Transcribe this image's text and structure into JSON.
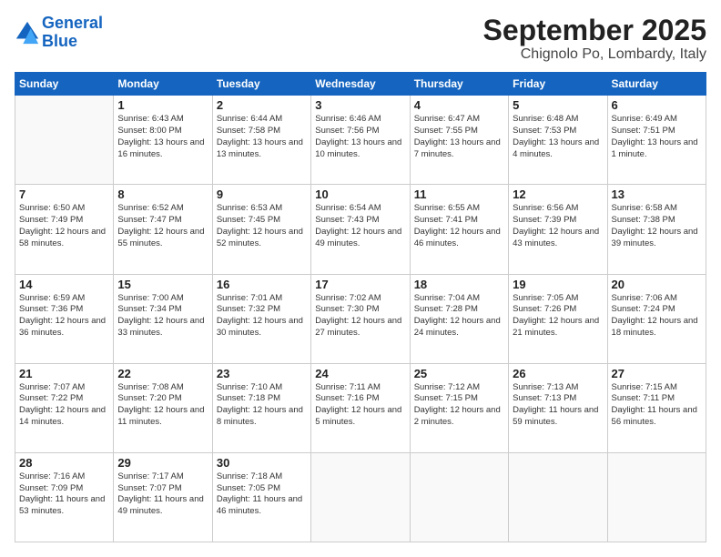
{
  "header": {
    "logo_line1": "General",
    "logo_line2": "Blue",
    "month": "September 2025",
    "location": "Chignolo Po, Lombardy, Italy"
  },
  "weekdays": [
    "Sunday",
    "Monday",
    "Tuesday",
    "Wednesday",
    "Thursday",
    "Friday",
    "Saturday"
  ],
  "weeks": [
    [
      {
        "day": null,
        "info": null
      },
      {
        "day": "1",
        "info": "Sunrise: 6:43 AM\nSunset: 8:00 PM\nDaylight: 13 hours\nand 16 minutes."
      },
      {
        "day": "2",
        "info": "Sunrise: 6:44 AM\nSunset: 7:58 PM\nDaylight: 13 hours\nand 13 minutes."
      },
      {
        "day": "3",
        "info": "Sunrise: 6:46 AM\nSunset: 7:56 PM\nDaylight: 13 hours\nand 10 minutes."
      },
      {
        "day": "4",
        "info": "Sunrise: 6:47 AM\nSunset: 7:55 PM\nDaylight: 13 hours\nand 7 minutes."
      },
      {
        "day": "5",
        "info": "Sunrise: 6:48 AM\nSunset: 7:53 PM\nDaylight: 13 hours\nand 4 minutes."
      },
      {
        "day": "6",
        "info": "Sunrise: 6:49 AM\nSunset: 7:51 PM\nDaylight: 13 hours\nand 1 minute."
      }
    ],
    [
      {
        "day": "7",
        "info": "Sunrise: 6:50 AM\nSunset: 7:49 PM\nDaylight: 12 hours\nand 58 minutes."
      },
      {
        "day": "8",
        "info": "Sunrise: 6:52 AM\nSunset: 7:47 PM\nDaylight: 12 hours\nand 55 minutes."
      },
      {
        "day": "9",
        "info": "Sunrise: 6:53 AM\nSunset: 7:45 PM\nDaylight: 12 hours\nand 52 minutes."
      },
      {
        "day": "10",
        "info": "Sunrise: 6:54 AM\nSunset: 7:43 PM\nDaylight: 12 hours\nand 49 minutes."
      },
      {
        "day": "11",
        "info": "Sunrise: 6:55 AM\nSunset: 7:41 PM\nDaylight: 12 hours\nand 46 minutes."
      },
      {
        "day": "12",
        "info": "Sunrise: 6:56 AM\nSunset: 7:39 PM\nDaylight: 12 hours\nand 43 minutes."
      },
      {
        "day": "13",
        "info": "Sunrise: 6:58 AM\nSunset: 7:38 PM\nDaylight: 12 hours\nand 39 minutes."
      }
    ],
    [
      {
        "day": "14",
        "info": "Sunrise: 6:59 AM\nSunset: 7:36 PM\nDaylight: 12 hours\nand 36 minutes."
      },
      {
        "day": "15",
        "info": "Sunrise: 7:00 AM\nSunset: 7:34 PM\nDaylight: 12 hours\nand 33 minutes."
      },
      {
        "day": "16",
        "info": "Sunrise: 7:01 AM\nSunset: 7:32 PM\nDaylight: 12 hours\nand 30 minutes."
      },
      {
        "day": "17",
        "info": "Sunrise: 7:02 AM\nSunset: 7:30 PM\nDaylight: 12 hours\nand 27 minutes."
      },
      {
        "day": "18",
        "info": "Sunrise: 7:04 AM\nSunset: 7:28 PM\nDaylight: 12 hours\nand 24 minutes."
      },
      {
        "day": "19",
        "info": "Sunrise: 7:05 AM\nSunset: 7:26 PM\nDaylight: 12 hours\nand 21 minutes."
      },
      {
        "day": "20",
        "info": "Sunrise: 7:06 AM\nSunset: 7:24 PM\nDaylight: 12 hours\nand 18 minutes."
      }
    ],
    [
      {
        "day": "21",
        "info": "Sunrise: 7:07 AM\nSunset: 7:22 PM\nDaylight: 12 hours\nand 14 minutes."
      },
      {
        "day": "22",
        "info": "Sunrise: 7:08 AM\nSunset: 7:20 PM\nDaylight: 12 hours\nand 11 minutes."
      },
      {
        "day": "23",
        "info": "Sunrise: 7:10 AM\nSunset: 7:18 PM\nDaylight: 12 hours\nand 8 minutes."
      },
      {
        "day": "24",
        "info": "Sunrise: 7:11 AM\nSunset: 7:16 PM\nDaylight: 12 hours\nand 5 minutes."
      },
      {
        "day": "25",
        "info": "Sunrise: 7:12 AM\nSunset: 7:15 PM\nDaylight: 12 hours\nand 2 minutes."
      },
      {
        "day": "26",
        "info": "Sunrise: 7:13 AM\nSunset: 7:13 PM\nDaylight: 11 hours\nand 59 minutes."
      },
      {
        "day": "27",
        "info": "Sunrise: 7:15 AM\nSunset: 7:11 PM\nDaylight: 11 hours\nand 56 minutes."
      }
    ],
    [
      {
        "day": "28",
        "info": "Sunrise: 7:16 AM\nSunset: 7:09 PM\nDaylight: 11 hours\nand 53 minutes."
      },
      {
        "day": "29",
        "info": "Sunrise: 7:17 AM\nSunset: 7:07 PM\nDaylight: 11 hours\nand 49 minutes."
      },
      {
        "day": "30",
        "info": "Sunrise: 7:18 AM\nSunset: 7:05 PM\nDaylight: 11 hours\nand 46 minutes."
      },
      {
        "day": null,
        "info": null
      },
      {
        "day": null,
        "info": null
      },
      {
        "day": null,
        "info": null
      },
      {
        "day": null,
        "info": null
      }
    ]
  ]
}
